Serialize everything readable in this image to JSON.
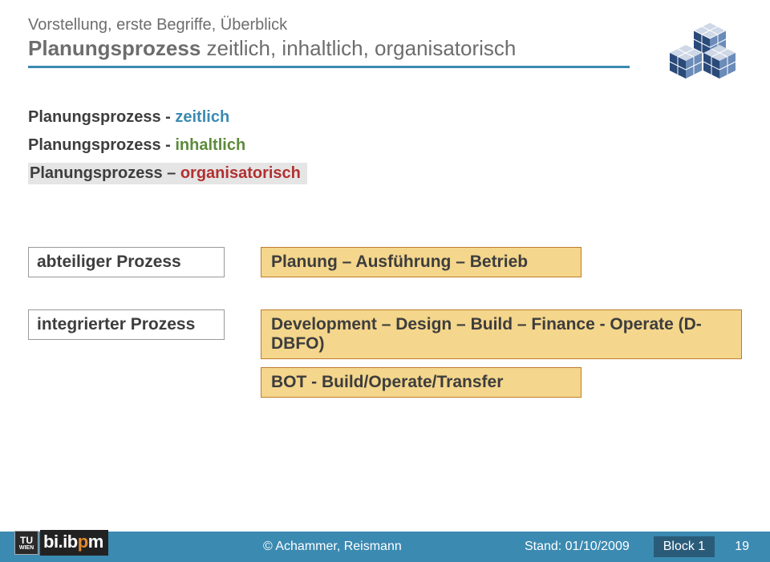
{
  "header": {
    "overline": "Vorstellung, erste Begriffe, Überblick",
    "title_strong": "Planungsprozess",
    "title_rest": " zeitlich, inhaltlich, organisatorisch"
  },
  "sections": {
    "item1_base": "Planungsprozess - ",
    "item1_colored": "zeitlich",
    "item2_base": "Planungsprozess - ",
    "item2_colored": "inhaltlich",
    "item3_base": "Planungsprozess – ",
    "item3_colored": "organisatorisch"
  },
  "processes": {
    "row1_label": "abteiliger Prozess",
    "row1_box": "Planung – Ausführung – Betrieb",
    "row2_label": "integrierter Prozess",
    "row2_box1": "Development – Design – Build – Finance - Operate (D-DBFO)",
    "row2_box2": "BOT - Build/Operate/Transfer"
  },
  "footer": {
    "copyright": "© Achammer, Reismann",
    "date": "Stand: 01/10/2009",
    "block": "Block 1",
    "page": "19",
    "logo_tu": "TU",
    "logo_wien": "WIEN",
    "logo_text": "bi.ibpm"
  }
}
